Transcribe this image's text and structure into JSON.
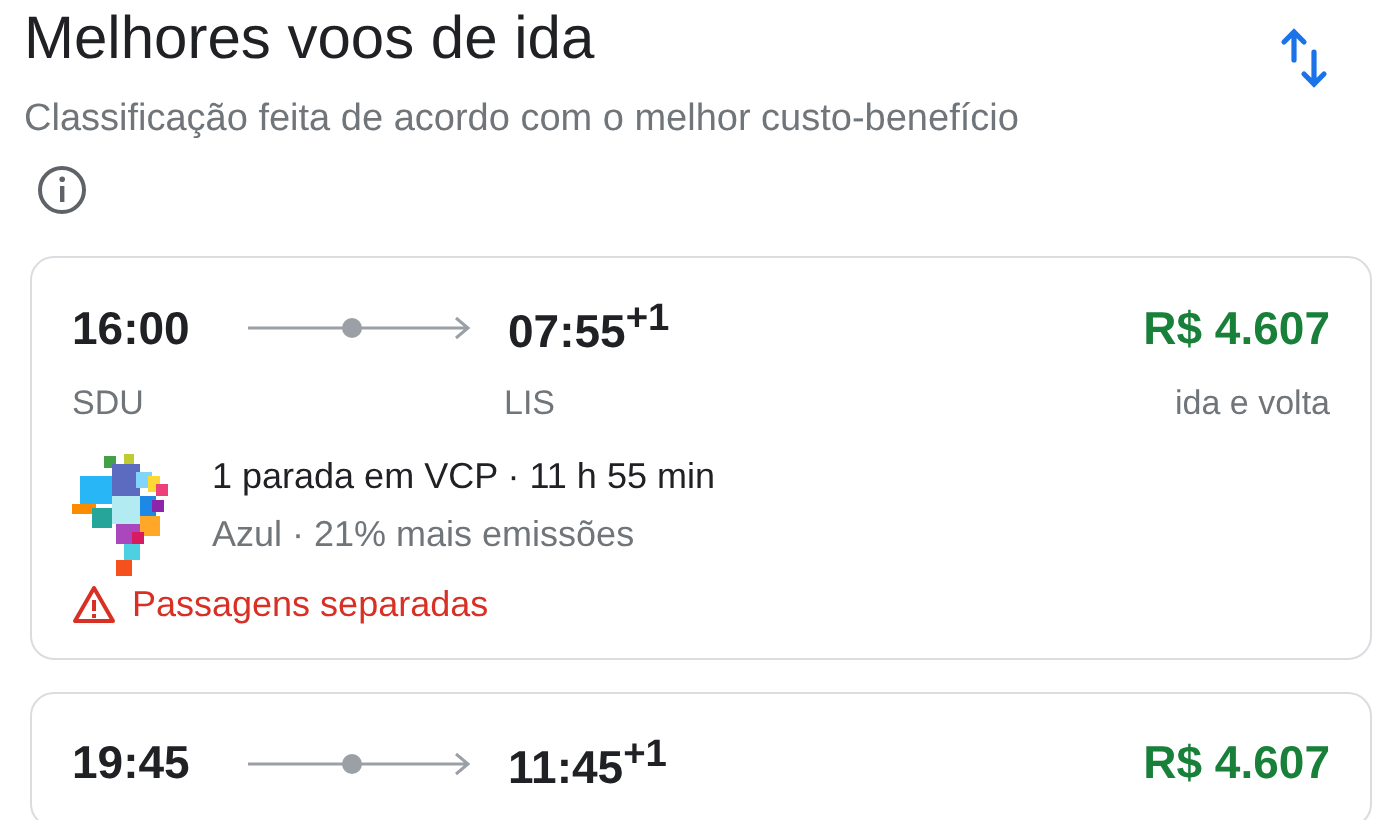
{
  "header": {
    "title": "Melhores voos de ida",
    "subtitle": "Classificação feita de acordo com o melhor custo-benefício"
  },
  "flights": [
    {
      "depart_time": "16:00",
      "arrive_time": "07:55$^{+1}$",
      "depart_code": "SDU",
      "arrive_code": "LIS",
      "price": "R$ 4.607",
      "price_note": "ida e volta",
      "stops": "1 parada em VCP · 11 h 55 min",
      "airline": "Azul · 21% mais emissões",
      "warning": "Passagens separadas"
    },
    {
      "depart_time": "19:45",
      "arrive_time": "11:45$^{+1}$",
      "price": "R$ 4.607"
    }
  ]
}
